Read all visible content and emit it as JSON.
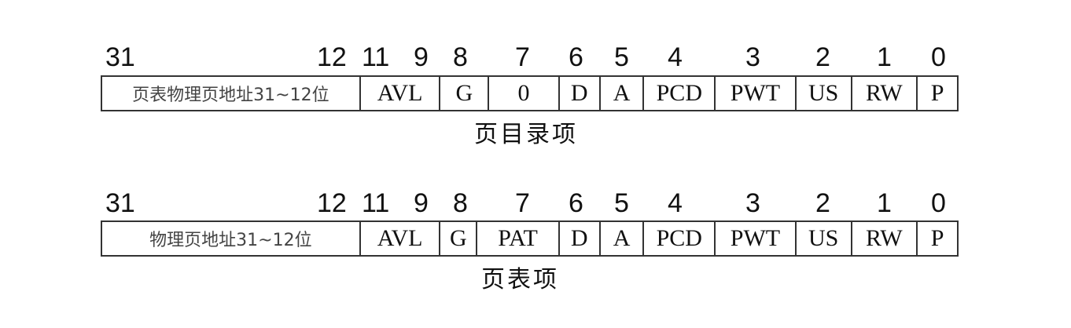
{
  "tables": [
    {
      "bit_numbers": [
        "31",
        "12",
        "11",
        "9",
        "8",
        "7",
        "6",
        "5",
        "4",
        "3",
        "2",
        "1",
        "0"
      ],
      "fields": [
        "页表物理页地址31~12位",
        "AVL",
        "G",
        "0",
        "D",
        "A",
        "PCD",
        "PWT",
        "US",
        "RW",
        "P"
      ],
      "caption": "页目录项"
    },
    {
      "bit_numbers": [
        "31",
        "12",
        "11",
        "9",
        "8",
        "7",
        "6",
        "5",
        "4",
        "3",
        "2",
        "1",
        "0"
      ],
      "fields": [
        "物理页地址31~12位",
        "AVL",
        "G",
        "PAT",
        "D",
        "A",
        "PCD",
        "PWT",
        "US",
        "RW",
        "P"
      ],
      "caption": "页表项"
    }
  ]
}
